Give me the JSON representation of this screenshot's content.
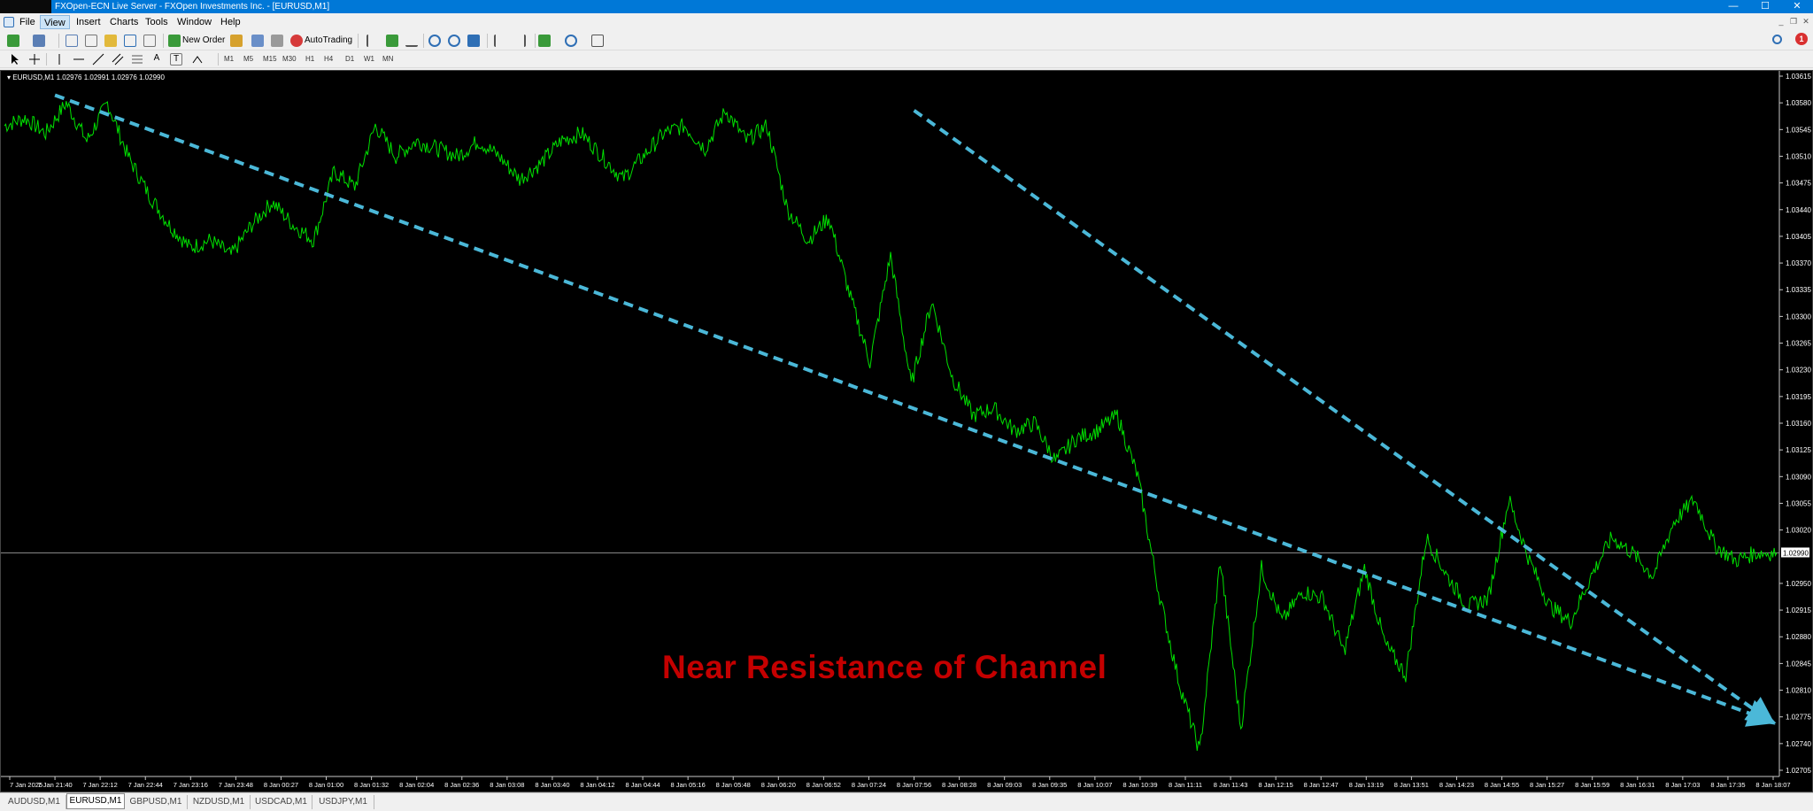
{
  "window": {
    "title": "FXOpen-ECN Live Server - FXOpen Investments Inc. - [EURUSD,M1]",
    "minimize": "—",
    "maximize": "☐",
    "close": "✕"
  },
  "menu": {
    "items": [
      "File",
      "View",
      "Insert",
      "Charts",
      "Tools",
      "Window",
      "Help"
    ],
    "active": "View"
  },
  "toolbar": {
    "new_order_label": "New Order",
    "autotrading_label": "AutoTrading",
    "timeframes": [
      "M1",
      "M5",
      "M15",
      "M30",
      "H1",
      "H4",
      "D1",
      "W1",
      "MN"
    ],
    "alert_count": "1"
  },
  "chart": {
    "symbol_info": "▾ EURUSD,M1  1.02976 1.02991 1.02976 1.02990",
    "overlay_text": "Near Resistance of Channel",
    "current_price_label": "1.02990",
    "colors": {
      "background": "#000000",
      "price_line": "#00e000",
      "trendline": "#4bb8d8",
      "overlay_text": "#c40000",
      "axis_text": "#ffffff"
    }
  },
  "chart_data": {
    "type": "line",
    "symbol": "EURUSD",
    "timeframe": "M1",
    "ylim": [
      1.027,
      1.0365
    ],
    "y_ticks": [
      "1.03615",
      "1.03580",
      "1.03545",
      "1.03510",
      "1.03475",
      "1.03440",
      "1.03405",
      "1.03370",
      "1.03335",
      "1.03300",
      "1.03265",
      "1.03230",
      "1.03195",
      "1.03160",
      "1.03125",
      "1.03090",
      "1.03055",
      "1.03020",
      "1.02990",
      "1.02950",
      "1.02915",
      "1.02880",
      "1.02845",
      "1.02810",
      "1.02775",
      "1.02740",
      "1.02705"
    ],
    "x_ticks": [
      "7 Jan 2025",
      "7 Jan 21:40",
      "7 Jan 22:12",
      "7 Jan 22:44",
      "7 Jan 23:16",
      "7 Jan 23:48",
      "8 Jan 00:27",
      "8 Jan 01:00",
      "8 Jan 01:32",
      "8 Jan 02:04",
      "8 Jan 02:36",
      "8 Jan 03:08",
      "8 Jan 03:40",
      "8 Jan 04:12",
      "8 Jan 04:44",
      "8 Jan 05:16",
      "8 Jan 05:48",
      "8 Jan 06:20",
      "8 Jan 06:52",
      "8 Jan 07:24",
      "8 Jan 07:56",
      "8 Jan 08:28",
      "8 Jan 09:03",
      "8 Jan 09:35",
      "8 Jan 10:07",
      "8 Jan 10:39",
      "8 Jan 11:11",
      "8 Jan 11:43",
      "8 Jan 12:15",
      "8 Jan 12:47",
      "8 Jan 13:19",
      "8 Jan 13:51",
      "8 Jan 14:23",
      "8 Jan 14:55",
      "8 Jan 15:27",
      "8 Jan 15:59",
      "8 Jan 16:31",
      "8 Jan 17:03",
      "8 Jan 17:35",
      "8 Jan 18:07"
    ],
    "series": [
      {
        "values": [
          1.0355,
          1.0356,
          1.0354,
          1.0358,
          1.0353,
          1.0358,
          1.0351,
          1.0346,
          1.0342,
          1.0339,
          1.034,
          1.0338,
          1.0342,
          1.0345,
          1.0342,
          1.034,
          1.0349,
          1.0347,
          1.0355,
          1.0351,
          1.0353,
          1.0352,
          1.0351,
          1.0353,
          1.0351,
          1.0348,
          1.035,
          1.0353,
          1.0354,
          1.0351,
          1.0348,
          1.0351,
          1.0354,
          1.0355,
          1.0352,
          1.0357,
          1.0353,
          1.0355,
          1.0344,
          1.034,
          1.0343,
          1.0333,
          1.0324,
          1.0338,
          1.0321,
          1.0332,
          1.0322,
          1.0317,
          1.0318,
          1.0315,
          1.0316,
          1.0311,
          1.0314,
          1.0315,
          1.0317,
          1.0309,
          1.0294,
          1.0282,
          1.0273,
          1.0298,
          1.0276,
          1.0297,
          1.029,
          1.0294,
          1.0293,
          1.0286,
          1.0297,
          1.0287,
          1.0283,
          1.0301,
          1.0296,
          1.0292,
          1.0293,
          1.0306,
          1.0298,
          1.0292,
          1.029,
          1.0296,
          1.0301,
          1.0299,
          1.0296,
          1.0303,
          1.0306,
          1.03,
          1.0298,
          1.0299,
          1.0299
        ]
      }
    ],
    "trendlines": [
      {
        "from": [
          "7 Jan 21:40",
          1.0359
        ],
        "to": [
          "8 Jan 18:07",
          1.0277
        ]
      },
      {
        "from": [
          "8 Jan 07:56",
          1.0357
        ],
        "to": [
          "8 Jan 18:07",
          1.0277
        ]
      }
    ],
    "annotations": [
      "Near Resistance of Channel"
    ],
    "grid": false
  },
  "tabs": {
    "items": [
      "AUDUSD,M1",
      "EURUSD,M1",
      "GBPUSD,M1",
      "NZDUSD,M1",
      "USDCAD,M1",
      "USDJPY,M1"
    ],
    "active": "EURUSD,M1"
  }
}
